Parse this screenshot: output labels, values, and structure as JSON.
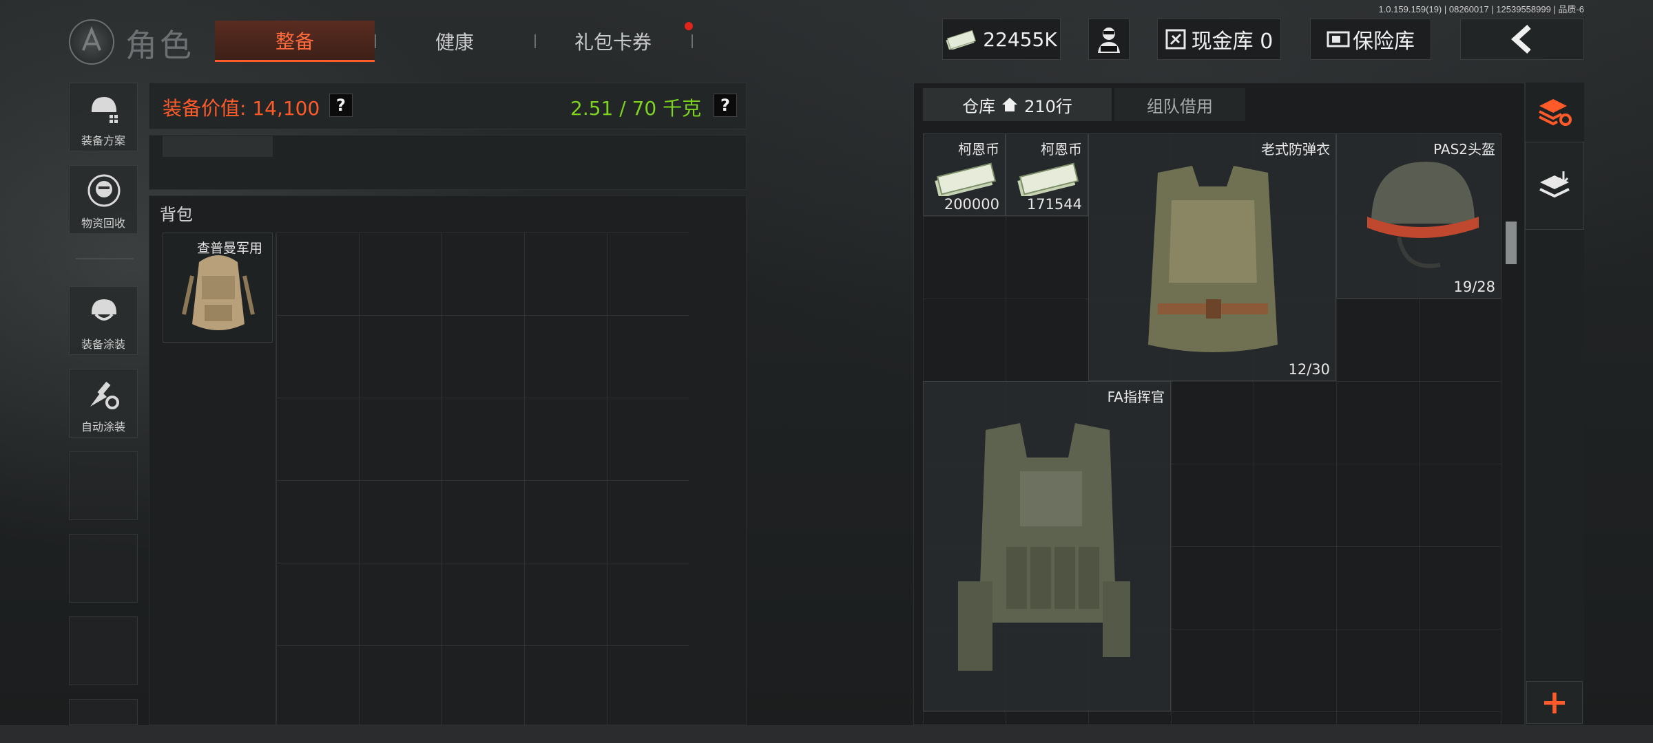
{
  "version_line": "1.0.159.159(19) | 08260017 | 12539558999 | 品质-6",
  "header": {
    "page_title": "角色",
    "tabs": [
      {
        "label": "整备",
        "active": true
      },
      {
        "label": "健康",
        "active": false
      },
      {
        "label": "礼包卡券",
        "active": false,
        "notification": true
      }
    ],
    "money": "22455K",
    "cash_vault": "现金库 0",
    "safe_vault": "保险库"
  },
  "sidebar": {
    "items": [
      {
        "label": "装备方案",
        "icon": "helmet-grid-icon"
      },
      {
        "label": "物资回收",
        "icon": "recycle-face-icon"
      },
      {
        "label": "装备涂装",
        "icon": "helmet-paint-icon"
      },
      {
        "label": "自动涂装",
        "icon": "brush-gear-icon"
      }
    ]
  },
  "equipment": {
    "value_label": "装备价值: 14,100",
    "help": "?",
    "weight": "2.51 / 70 千克",
    "backpack_label": "背包",
    "backpack_item": "查普曼军用"
  },
  "warehouse": {
    "tab_main": "仓库",
    "tab_main_rows": "210行",
    "tab_team": "组队借用",
    "items": [
      {
        "name": "柯恩币",
        "count": "200000",
        "icon": "cash-stack-icon"
      },
      {
        "name": "柯恩币",
        "count": "171544",
        "icon": "cash-stack-icon"
      },
      {
        "name": "老式防弹衣",
        "count": "12/30",
        "icon": "old-vest-icon"
      },
      {
        "name": "PAS2头盔",
        "count": "19/28",
        "icon": "helmet-icon"
      },
      {
        "name": "FA指挥官",
        "count": "",
        "icon": "tactical-vest-icon"
      }
    ],
    "plus": "+"
  },
  "colors": {
    "accent": "#ff5a2a",
    "weight_green": "#7ed321",
    "notification": "#e0251c"
  }
}
